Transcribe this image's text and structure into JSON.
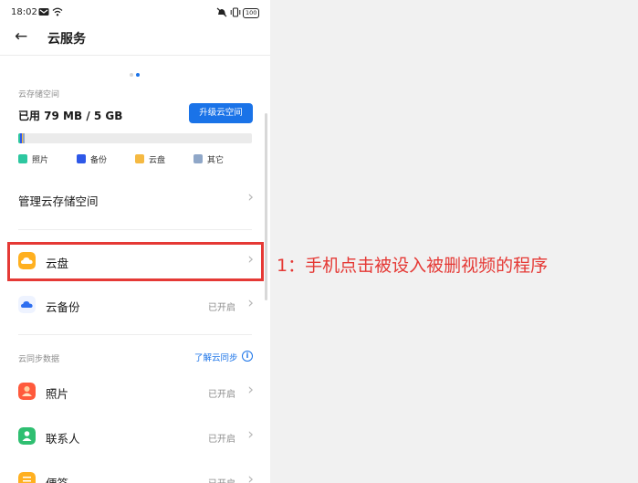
{
  "status_bar": {
    "time": "18:02",
    "battery": "100"
  },
  "header": {
    "title": "云服务"
  },
  "storage": {
    "section_label": "云存储空间",
    "used_text": "已用 79 MB / 5 GB",
    "upgrade_label": "升级云空间",
    "legend": [
      {
        "label": "照片",
        "color": "#2dc7a0"
      },
      {
        "label": "备份",
        "color": "#2e58e8"
      },
      {
        "label": "云盘",
        "color": "#f5b942"
      },
      {
        "label": "其它",
        "color": "#8fa7c8"
      }
    ],
    "manage_label": "管理云存储空间"
  },
  "rows": {
    "cloud_disk": {
      "label": "云盘"
    },
    "cloud_backup": {
      "label": "云备份",
      "status": "已开启"
    }
  },
  "sync": {
    "section_label": "云同步数据",
    "link_label": "了解云同步",
    "items": [
      {
        "label": "照片",
        "status": "已开启"
      },
      {
        "label": "联系人",
        "status": "已开启"
      },
      {
        "label": "便签",
        "status": "已开启"
      }
    ]
  },
  "annotation": {
    "text": "1：手机点击被设入被删视频的程序",
    "color": "#e53935"
  }
}
